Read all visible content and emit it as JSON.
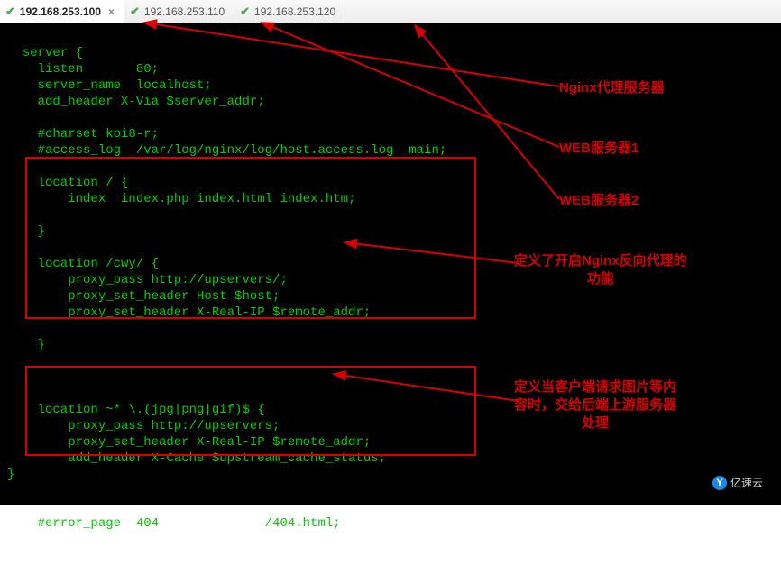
{
  "tabs": [
    {
      "ip": "192.168.253.100",
      "active": true,
      "has_close": true
    },
    {
      "ip": "192.168.253.110",
      "active": false,
      "has_close": false
    },
    {
      "ip": "192.168.253.120",
      "active": false,
      "has_close": false
    }
  ],
  "icons": {
    "check": "✔",
    "close": "×"
  },
  "config_text": "server {\n    listen       80;\n    server_name  localhost;\n    add_header X-Via $server_addr;\n\n    #charset koi8-r;\n    #access_log  /var/log/nginx/log/host.access.log  main;\n\n    location / {\n        index  index.php index.html index.htm;\n\n    }\n\n    location /cwy/ {\n        proxy_pass http://upservers/;\n        proxy_set_header Host $host;\n        proxy_set_header X-Real-IP $remote_addr;\n\n    }\n\n\n\n    location ~* \\.(jpg|png|gif)$ {\n        proxy_pass http://upservers;\n        proxy_set_header X-Real-IP $remote_addr;\n        add_header X-Cache $upstream_cache_status;\n}\n\n\n    #error_page  404              /404.html;",
  "annotations": {
    "nginx_proxy": "Nginx代理服务器",
    "web1": "WEB服务器1",
    "web2": "WEB服务器2",
    "reverse_proxy": "定义了开启Nginx反向代理的\n功能",
    "image_proxy": "定义当客户端请求图片等内\n容时，交给后端上游服务器\n处理"
  },
  "watermark_text": "亿速云"
}
